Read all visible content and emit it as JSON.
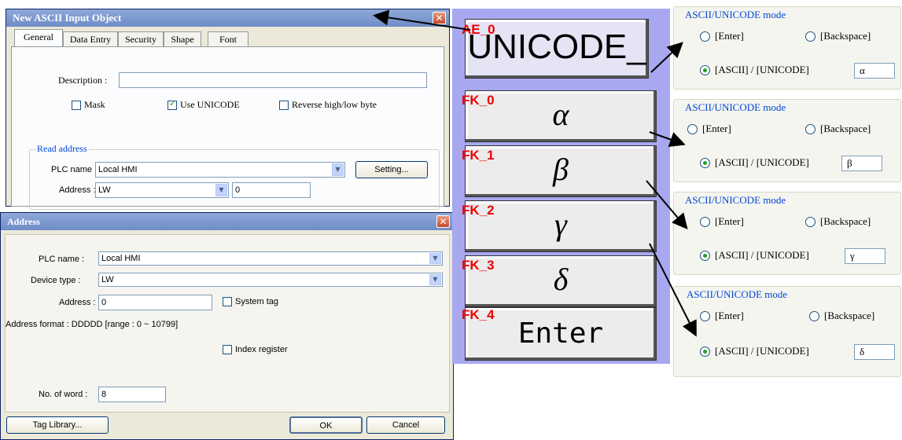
{
  "ascii_dialog": {
    "title": "New  ASCII Input Object",
    "tabs": [
      "General",
      "Data Entry",
      "Security",
      "Shape",
      "Font"
    ],
    "description_label": "Description :",
    "description_value": "",
    "mask_label": "Mask",
    "use_unicode_label": "Use UNICODE",
    "reverse_label": "Reverse high/low byte",
    "read_address_group": "Read address",
    "plc_name_label": "PLC name :",
    "plc_name_value": "Local HMI",
    "setting_button": "Setting...",
    "address_label": "Address :",
    "address_device": "LW",
    "address_value": "0"
  },
  "address_dialog": {
    "title": "Address",
    "plc_name_label": "PLC name :",
    "plc_name_value": "Local HMI",
    "device_type_label": "Device type :",
    "device_type_value": "LW",
    "address_label": "Address :",
    "address_value": "0",
    "system_tag_label": "System tag",
    "address_format": "Address format : DDDDD [range : 0 ~ 10799]",
    "index_register_label": "Index register",
    "no_of_word_label": "No. of word :",
    "no_of_word_value": "8",
    "tag_library_button": "Tag Library...",
    "ok_button": "OK",
    "cancel_button": "Cancel"
  },
  "keypad": {
    "display_label": "AE_0",
    "display_value": "UNICODE_",
    "keys": [
      {
        "label": "FK_0",
        "glyph": "α"
      },
      {
        "label": "FK_1",
        "glyph": "β"
      },
      {
        "label": "FK_2",
        "glyph": "γ"
      },
      {
        "label": "FK_3",
        "glyph": "δ"
      },
      {
        "label": "FK_4",
        "glyph": "Enter"
      }
    ]
  },
  "mode_panels": {
    "title": "ASCII/UNICODE mode",
    "enter_label": "[Enter]",
    "backspace_label": "[Backspace]",
    "ascii_label": "[ASCII] / [UNICODE]",
    "values": [
      "α",
      "β",
      "γ",
      "δ"
    ]
  },
  "colors": {
    "accent_red": "#e00000",
    "keypad_bg": "#a8a8f0",
    "group_title": "#0046d5"
  }
}
